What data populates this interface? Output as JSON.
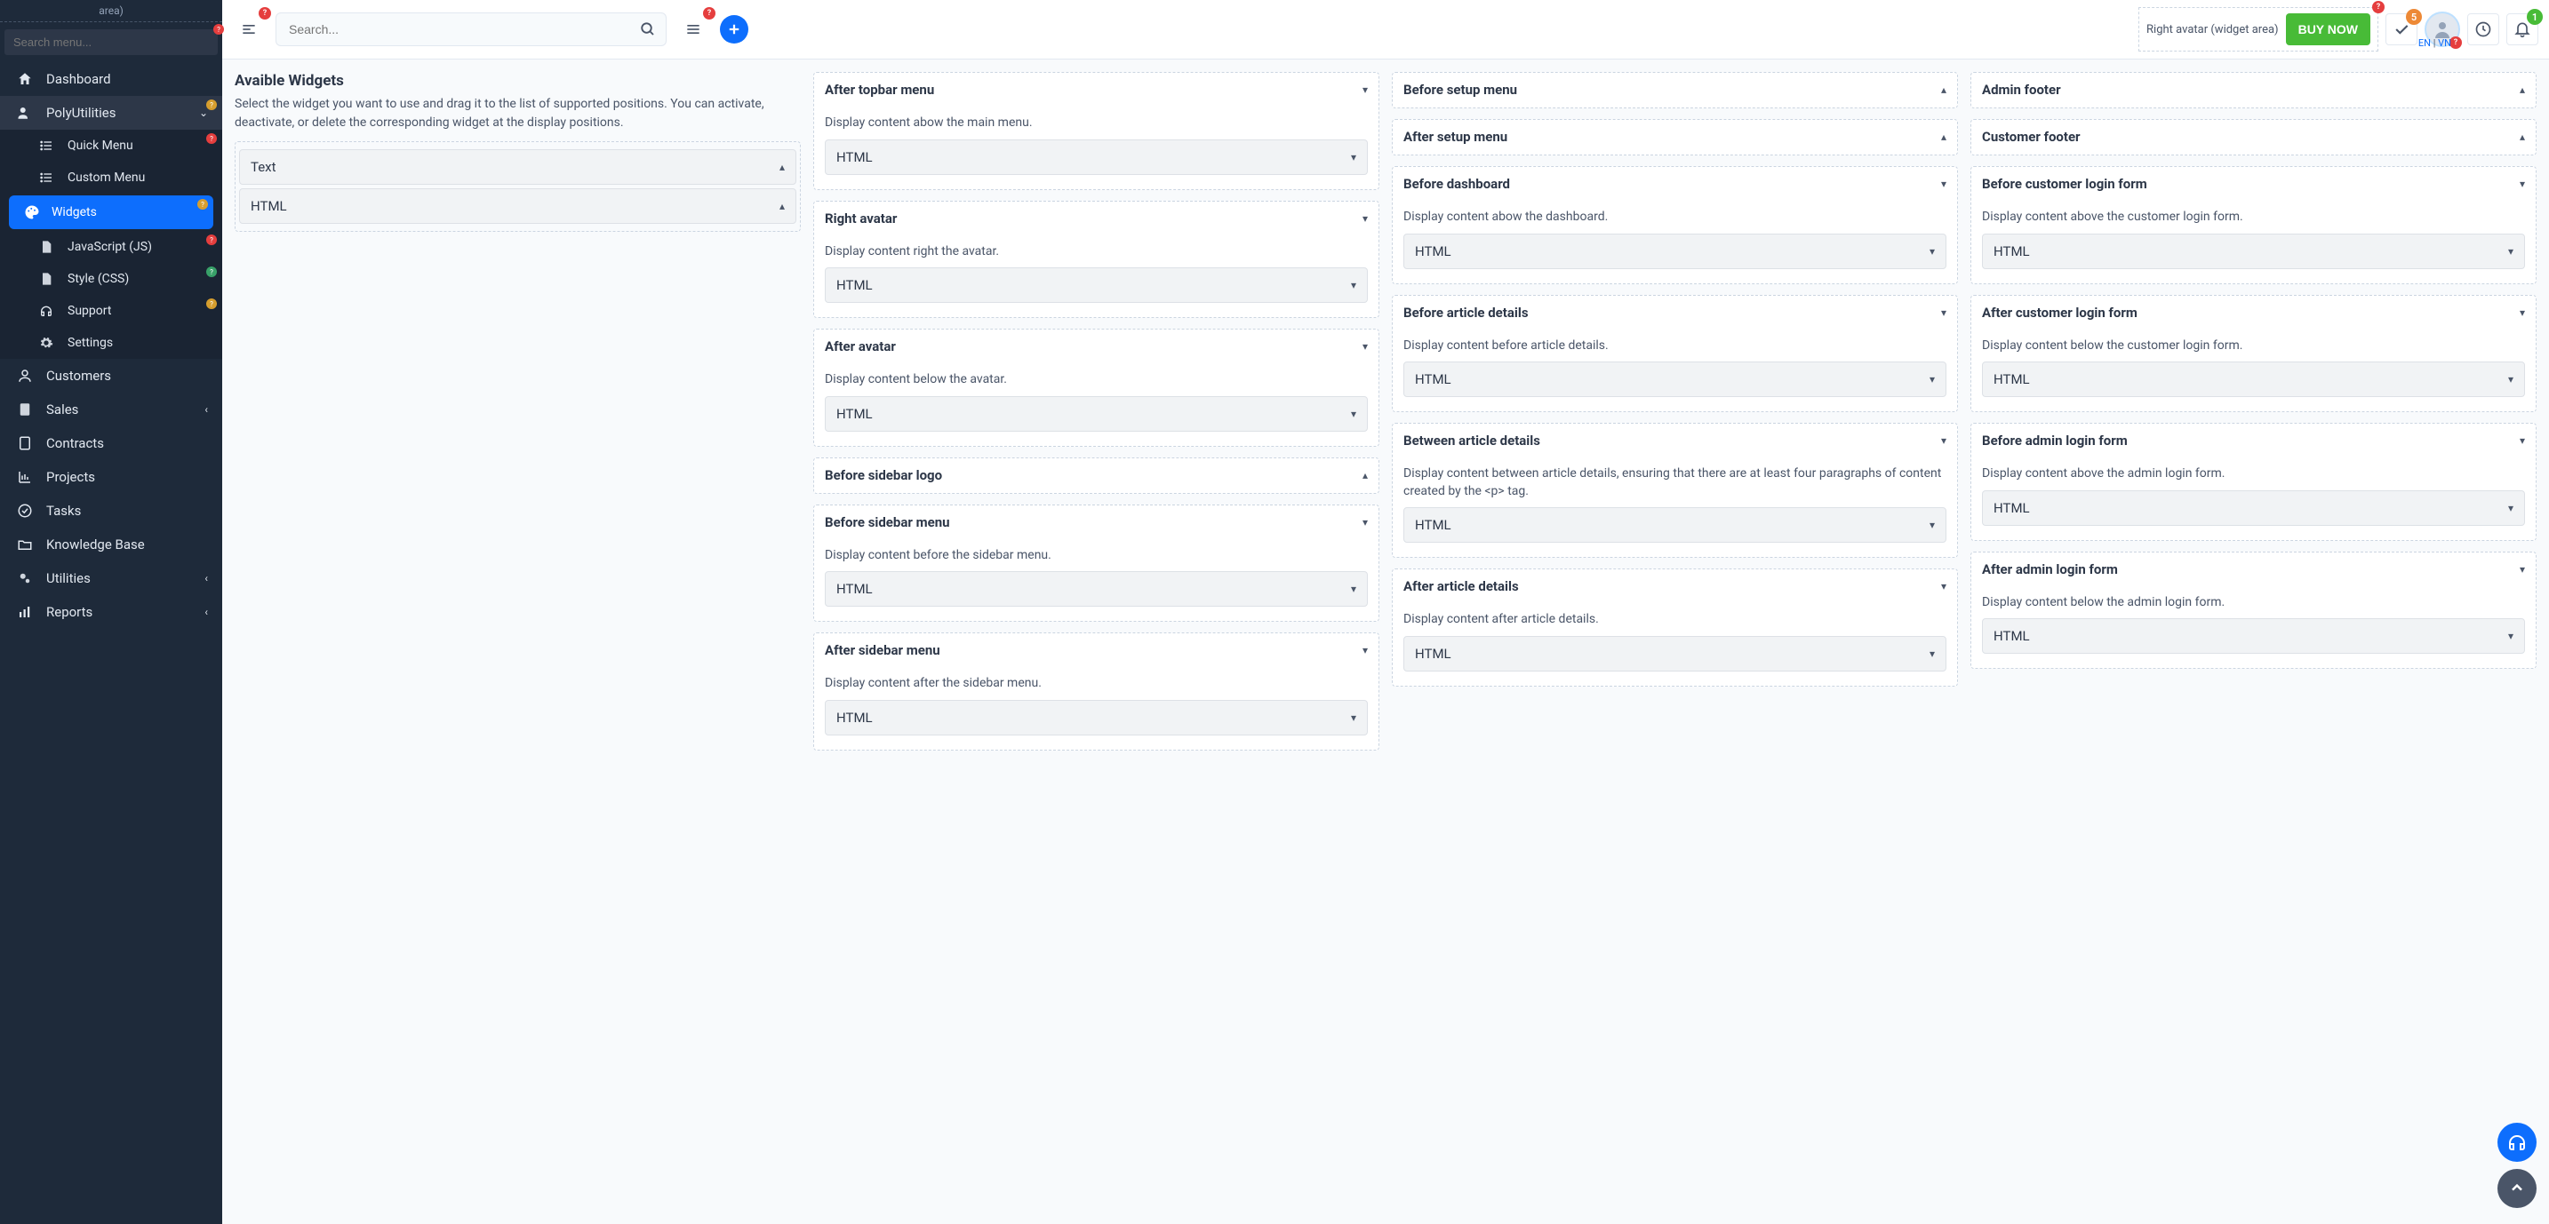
{
  "sidebar": {
    "top_hint": "area)",
    "search_placeholder": "Search menu...",
    "items": {
      "dashboard": "Dashboard",
      "polyutilities": "PolyUtilities",
      "quick_menu": "Quick Menu",
      "custom_menu": "Custom Menu",
      "widgets": "Widgets",
      "javascript": "JavaScript (JS)",
      "style": "Style (CSS)",
      "support": "Support",
      "settings": "Settings",
      "customers": "Customers",
      "sales": "Sales",
      "contracts": "Contracts",
      "projects": "Projects",
      "tasks": "Tasks",
      "knowledge_base": "Knowledge Base",
      "utilities": "Utilities",
      "reports": "Reports"
    }
  },
  "topbar": {
    "search_placeholder": "Search...",
    "right_widget_text": "Right avatar (widget area)",
    "buy_now": "BUY NOW",
    "badge_check": "5",
    "badge_bell": "1",
    "lang_en": "EN",
    "lang_vn": "VN"
  },
  "available": {
    "title": "Avaible Widgets",
    "desc": "Select the widget you want to use and drag it to the list of supported positions. You can activate, deactivate, or delete the corresponding widget at the display positions.",
    "items": {
      "text": "Text",
      "html": "HTML"
    }
  },
  "positions": {
    "after_topbar_menu": {
      "title": "After topbar menu",
      "desc": "Display content abow the main menu.",
      "widget": "HTML"
    },
    "right_avatar": {
      "title": "Right avatar",
      "desc": "Display content right the avatar.",
      "widget": "HTML"
    },
    "after_avatar": {
      "title": "After avatar",
      "desc": "Display content below the avatar.",
      "widget": "HTML"
    },
    "before_sidebar_logo": {
      "title": "Before sidebar logo"
    },
    "before_sidebar_menu": {
      "title": "Before sidebar menu",
      "desc": "Display content before the sidebar menu.",
      "widget": "HTML"
    },
    "after_sidebar_menu": {
      "title": "After sidebar menu",
      "desc": "Display content after the sidebar menu.",
      "widget": "HTML"
    },
    "before_setup_menu": {
      "title": "Before setup menu"
    },
    "after_setup_menu": {
      "title": "After setup menu"
    },
    "before_dashboard": {
      "title": "Before dashboard",
      "desc": "Display content abow the dashboard.",
      "widget": "HTML"
    },
    "before_article": {
      "title": "Before article details",
      "desc": "Display content before article details.",
      "widget": "HTML"
    },
    "between_article": {
      "title": "Between article details",
      "desc": "Display content between article details, ensuring that there are at least four paragraphs of content created by the <p> tag.",
      "widget": "HTML"
    },
    "after_article": {
      "title": "After article details",
      "desc": "Display content after article details.",
      "widget": "HTML"
    },
    "admin_footer": {
      "title": "Admin footer"
    },
    "customer_footer": {
      "title": "Customer footer"
    },
    "before_customer_login": {
      "title": "Before customer login form",
      "desc": "Display content above the customer login form.",
      "widget": "HTML"
    },
    "after_customer_login": {
      "title": "After customer login form",
      "desc": "Display content below the customer login form.",
      "widget": "HTML"
    },
    "before_admin_login": {
      "title": "Before admin login form",
      "desc": "Display content above the admin login form.",
      "widget": "HTML"
    },
    "after_admin_login": {
      "title": "After admin login form",
      "desc": "Display content below the admin login form.",
      "widget": "HTML"
    }
  }
}
